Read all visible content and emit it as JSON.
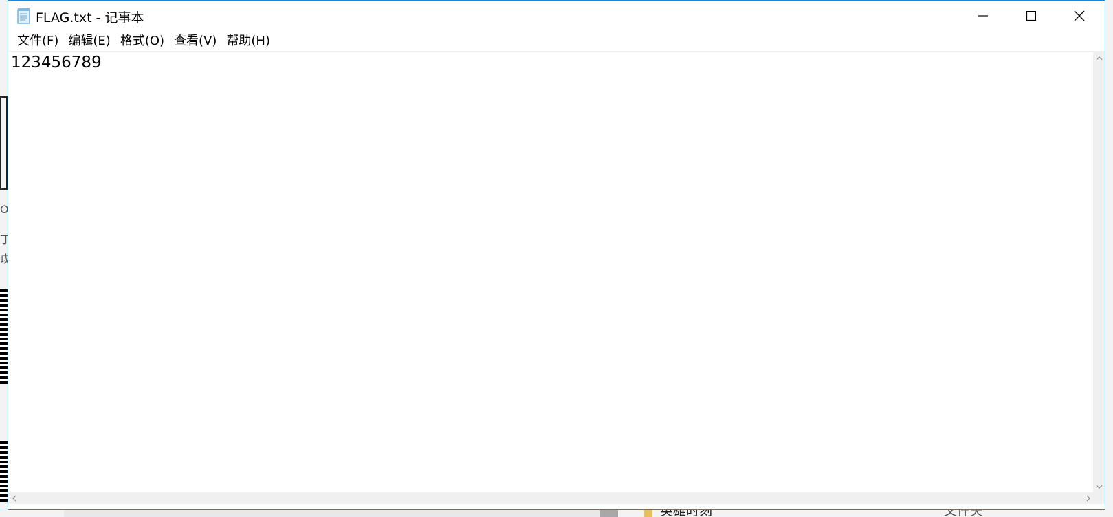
{
  "window": {
    "title": "FLAG.txt - 记事本",
    "app_icon": "notepad-icon",
    "border_color": "#1883d7"
  },
  "menu": {
    "items": [
      {
        "label": "文件(F)"
      },
      {
        "label": "编辑(E)"
      },
      {
        "label": "格式(O)"
      },
      {
        "label": "查看(V)"
      },
      {
        "label": "帮助(H)"
      }
    ]
  },
  "editor": {
    "content": "123456789"
  },
  "background": {
    "folder_item_label": "英雄时刻",
    "type_label": "文件夹"
  }
}
